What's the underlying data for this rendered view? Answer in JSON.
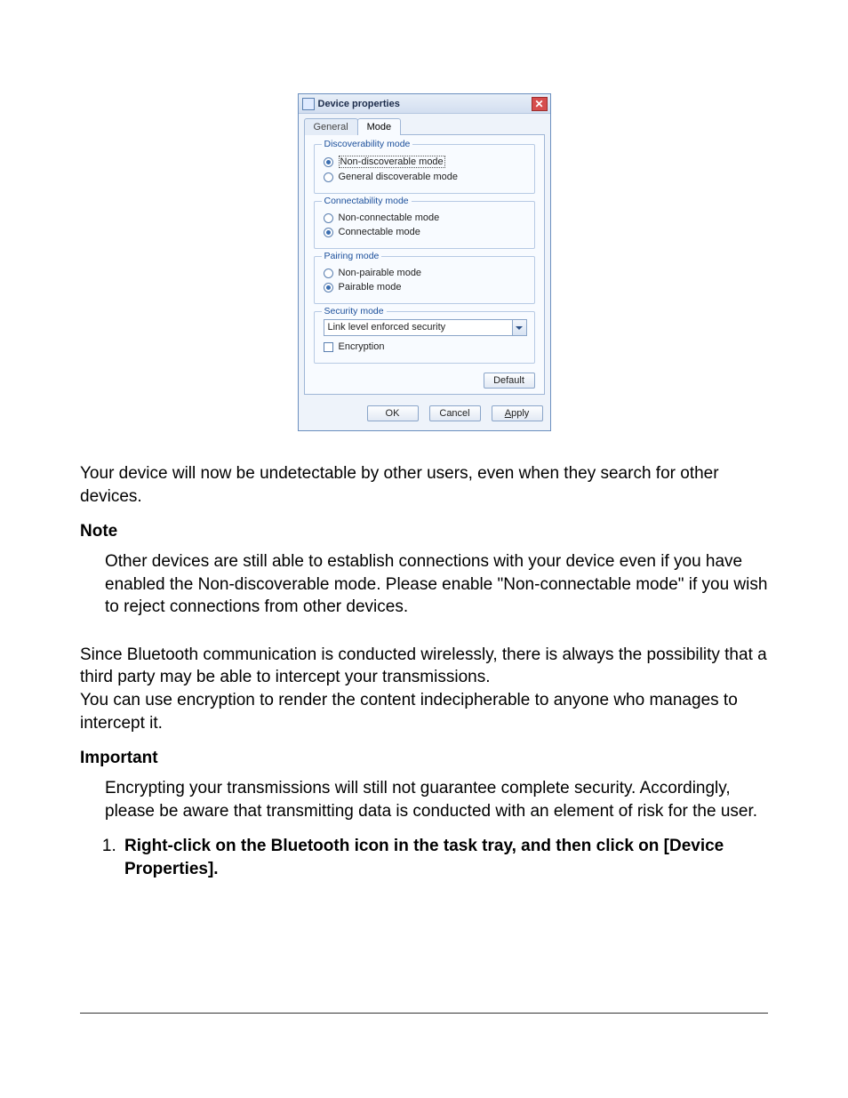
{
  "dialog": {
    "title": "Device properties",
    "tabs": {
      "general": "General",
      "mode": "Mode"
    },
    "groups": {
      "discoverability": {
        "legend": "Discoverability mode",
        "options": {
          "non_discoverable": "Non-discoverable mode",
          "general_discoverable": "General discoverable mode"
        }
      },
      "connectability": {
        "legend": "Connectability mode",
        "options": {
          "non_connectable": "Non-connectable mode",
          "connectable": "Connectable mode"
        }
      },
      "pairing": {
        "legend": "Pairing mode",
        "options": {
          "non_pairable": "Non-pairable mode",
          "pairable": "Pairable mode"
        }
      },
      "security": {
        "legend": "Security mode",
        "selected": "Link level enforced security",
        "encryption_label": "Encryption"
      }
    },
    "buttons": {
      "default": "Default",
      "ok": "OK",
      "cancel": "Cancel",
      "apply_prefix": "A",
      "apply_rest": "pply"
    }
  },
  "body": {
    "p1": "Your device will now be undetectable by other users, even when they search for other devices.",
    "note_heading": "Note",
    "note_body": "Other devices are still able to establish connections with your device even if you have enabled the Non-discoverable mode. Please enable \"Non-connectable mode\" if you wish to reject connections from   other devices.",
    "p2a": "Since Bluetooth communication is conducted wirelessly, there is always the possibility that a third party may be able to intercept your transmissions.",
    "p2b": "You can use encryption to render the content indecipherable to anyone who manages to intercept it.",
    "important_heading": "Important",
    "important_body": "Encrypting your transmissions will still not guarantee complete security. Accordingly, please be aware that transmitting data is conducted with an element of risk for the user.",
    "step1": "Right-click on the Bluetooth icon in the task tray, and then click on [Device Properties]."
  }
}
